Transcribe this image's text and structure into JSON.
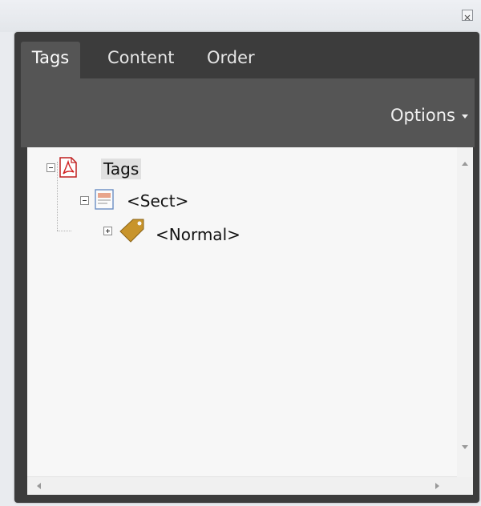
{
  "window": {
    "close_icon": "close-icon"
  },
  "tabs": [
    {
      "label": "Tags",
      "active": true
    },
    {
      "label": "Content",
      "active": false
    },
    {
      "label": "Order",
      "active": false
    }
  ],
  "toolbar": {
    "options_label": "Options",
    "options_icon": "dropdown-caret-icon"
  },
  "tree": {
    "root": {
      "label": "Tags",
      "icon": "pdf-document-icon",
      "expanded": true
    },
    "sect": {
      "label": "<Sect>",
      "icon": "section-icon",
      "expanded": true
    },
    "normal": {
      "label": "<Normal>",
      "icon": "tag-icon",
      "expanded": false
    }
  },
  "colors": {
    "panel_dark": "#3c3c3c",
    "tab_active": "#555555",
    "tree_background": "#f7f7f7",
    "pdf_red": "#d11f1f",
    "tag_gold": "#c8942b"
  }
}
